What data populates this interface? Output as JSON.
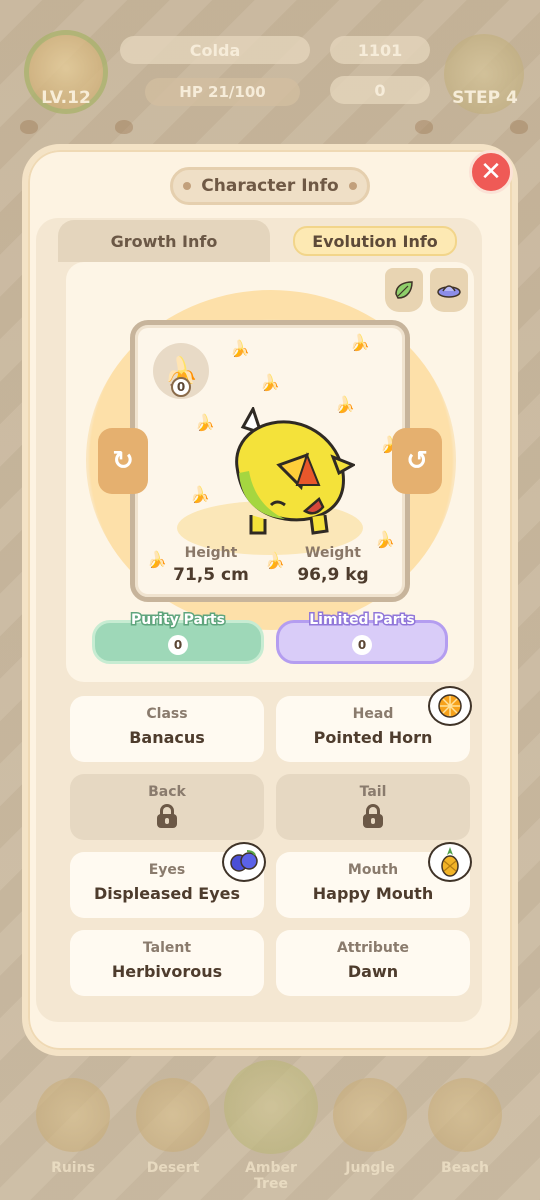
{
  "hud": {
    "level": "LV.12",
    "name": "Colda",
    "coins": "1101",
    "hp": "HP 21/100",
    "zero": "0",
    "step": "STEP 4"
  },
  "modal": {
    "title": "Character Info",
    "close_label": "✕",
    "tabs": [
      {
        "label": "Growth Info",
        "active": false
      },
      {
        "label": "Evolution Info",
        "active": true
      }
    ]
  },
  "character": {
    "food_count": "0",
    "height_label": "Height",
    "height_value": "71,5 cm",
    "weight_label": "Weight",
    "weight_value": "96,9 kg",
    "rotate_left": "↻",
    "rotate_right": "↺"
  },
  "parts": {
    "purity_label": "Purity Parts",
    "purity_count": "0",
    "limited_label": "Limited Parts",
    "limited_count": "0"
  },
  "attributes": [
    {
      "label": "Class",
      "value": "Banacus"
    },
    {
      "label": "Head",
      "value": "Pointed Horn"
    },
    {
      "label": "Back",
      "value": "",
      "locked": true
    },
    {
      "label": "Tail",
      "value": "",
      "locked": true
    },
    {
      "label": "Eyes",
      "value": "Displeased Eyes"
    },
    {
      "label": "Mouth",
      "value": "Happy Mouth"
    },
    {
      "label": "Talent",
      "value": "Herbivorous"
    },
    {
      "label": "Attribute",
      "value": "Dawn"
    }
  ],
  "nav": [
    {
      "label": "Ruins"
    },
    {
      "label": "Desert"
    },
    {
      "label": "Amber Tree",
      "active": true
    },
    {
      "label": "Jungle"
    },
    {
      "label": "Beach"
    }
  ],
  "colors": {
    "close": "#ef5a56",
    "purity": "#9ed8b8",
    "limited": "#d9ccf8",
    "accent": "#e5b06f"
  }
}
